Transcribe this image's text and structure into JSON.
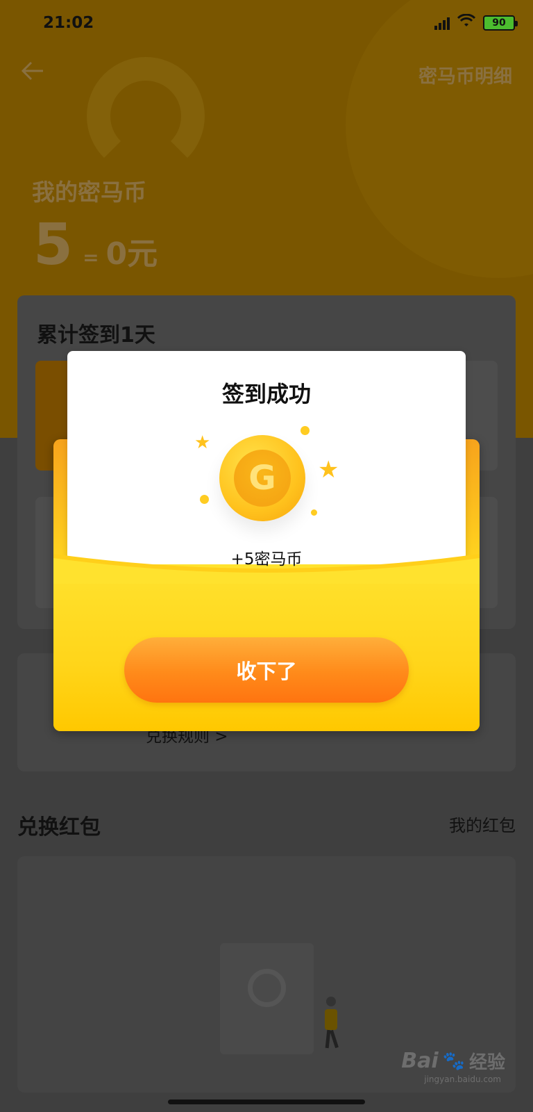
{
  "status_bar": {
    "time": "21:02",
    "battery": "90"
  },
  "header": {
    "back_icon": "arrow-left-icon",
    "detail_link": "密马币明细"
  },
  "balance": {
    "label": "我的密马币",
    "amount": "5",
    "equals": "=",
    "cash": "0元"
  },
  "sign_card": {
    "title": "累计签到1天"
  },
  "exchange_card": {
    "rules_link": "兑换规则 >"
  },
  "redpacket_section": {
    "title": "兑换红包",
    "my_link": "我的红包"
  },
  "modal": {
    "title": "签到成功",
    "coin_letter": "G",
    "reward": "+5密马币",
    "accept_button": "收下了"
  },
  "watermark": {
    "brand": "Bai",
    "paw": "🐾",
    "brand_suffix": "经验",
    "url": "jingyan.baidu.com"
  },
  "colors": {
    "accent": "#ff8a1a",
    "envelope": "#ffd51f",
    "coin": "#ffc21d"
  }
}
